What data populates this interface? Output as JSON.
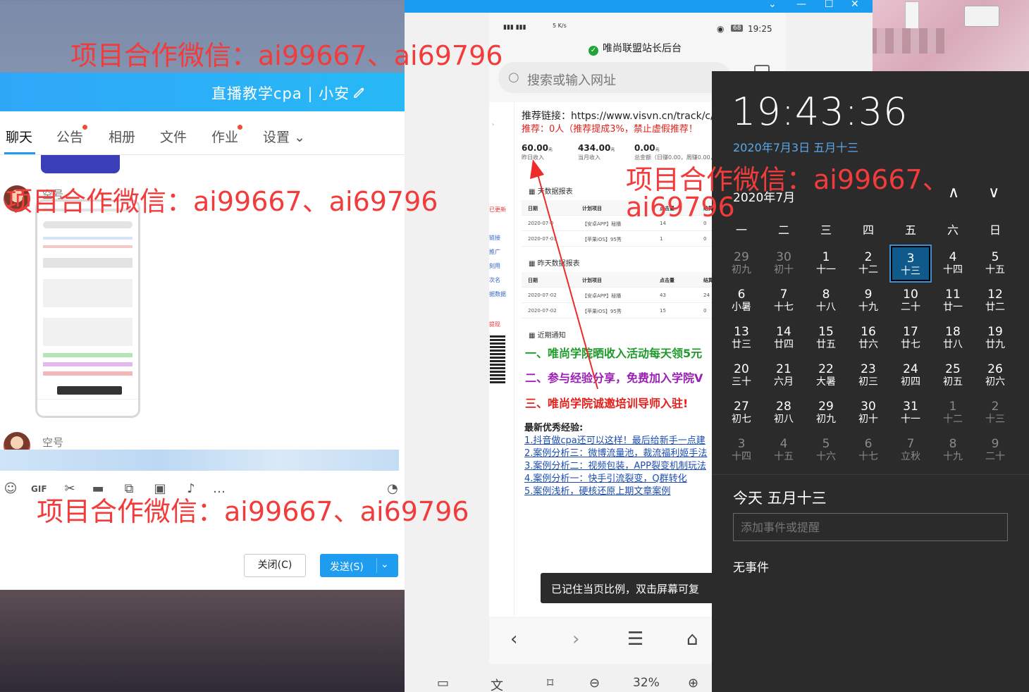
{
  "qq_window": {
    "title": "直播教学cpa | 小安",
    "tabs": [
      {
        "label": "聊天"
      },
      {
        "label": "公告"
      },
      {
        "label": "相册"
      },
      {
        "label": "文件"
      },
      {
        "label": "作业"
      },
      {
        "label": "设置"
      }
    ],
    "sender_top": "空号",
    "sender_bottom": "空号",
    "close_button": "关闭(C)",
    "send_button": "发送(S)"
  },
  "phone": {
    "status_speed": "5 K/s",
    "battery": "68",
    "time": "19:25",
    "site_title": "唯尚联盟站长后台",
    "search_placeholder": "搜索或输入网址",
    "referral_link": "推荐链接：https://www.visvn.cn/track/c/",
    "referral_note": "推荐：0人（推荐提成3%，禁止虚假推荐！",
    "stats": [
      {
        "value": "60.00",
        "unit": "元",
        "label": "昨日收入"
      },
      {
        "value": "434.00",
        "unit": "元",
        "label": "当月收入"
      },
      {
        "value": "0.00",
        "unit": "元",
        "label": "总金额（日赚0.00，周赚0.00，下线"
      }
    ],
    "section_today": "天数据报表",
    "section_yesterday": "昨天数据报表",
    "section_notice": "近期通知",
    "table_headers": [
      "日期",
      "计划项目",
      "点击量",
      "结算"
    ],
    "today_rows": [
      [
        "2020-07-0",
        "【安卓APP】秘播",
        "14",
        "0"
      ],
      [
        "2020-07-03",
        "【苹果iOS】95秀",
        "1",
        "0"
      ]
    ],
    "yesterday_rows": [
      [
        "2020-07-02",
        "【安卓APP】秘播",
        "43",
        "24"
      ],
      [
        "2020-07-02",
        "【苹果iOS】95秀",
        "15",
        "0"
      ]
    ],
    "left_links": [
      "已更新",
      "链接",
      "推广",
      "刻用",
      "次名",
      "据数据",
      "提现"
    ],
    "notices": [
      {
        "text": "一、唯尚学院晒收入活动每天领5元",
        "color": "#1f9a2b"
      },
      {
        "text": "二、参与经验分享，免费加入学院V",
        "color": "#9b1fb5"
      },
      {
        "text": "三、唯尚学院诚邀培训导师入驻!",
        "color": "#e3201b"
      }
    ],
    "experience_title": "最新优秀经验:",
    "experience_links": [
      "1.抖音做cpa还可以这样！最后给新手一点建",
      "2.案例分析三：微博流量池，裁流福利姬手法",
      "3.案例分析二：视频包装，APP裂变机制玩法",
      "4.案例分析一：快手引流裂变，Q群转化",
      "5.案例浅析，硬核还原上期文章案例"
    ],
    "toast": "已记住当页比例，双击屏幕可复",
    "zoom": "32%"
  },
  "calendar": {
    "time": "19:43:36",
    "date_line": "2020年7月3日 五月十三",
    "month": "2020年7月",
    "weekdays": [
      "一",
      "二",
      "三",
      "四",
      "五",
      "六",
      "日"
    ],
    "days": [
      {
        "n": "29",
        "l": "初九",
        "dim": true
      },
      {
        "n": "30",
        "l": "初十",
        "dim": true
      },
      {
        "n": "1",
        "l": "十一"
      },
      {
        "n": "2",
        "l": "十二"
      },
      {
        "n": "3",
        "l": "十三",
        "today": true
      },
      {
        "n": "4",
        "l": "十四"
      },
      {
        "n": "5",
        "l": "十五"
      },
      {
        "n": "6",
        "l": "小暑"
      },
      {
        "n": "7",
        "l": "十七"
      },
      {
        "n": "8",
        "l": "十八"
      },
      {
        "n": "9",
        "l": "十九"
      },
      {
        "n": "10",
        "l": "二十"
      },
      {
        "n": "11",
        "l": "廿一"
      },
      {
        "n": "12",
        "l": "廿二"
      },
      {
        "n": "13",
        "l": "廿三"
      },
      {
        "n": "14",
        "l": "廿四"
      },
      {
        "n": "15",
        "l": "廿五"
      },
      {
        "n": "16",
        "l": "廿六"
      },
      {
        "n": "17",
        "l": "廿七"
      },
      {
        "n": "18",
        "l": "廿八"
      },
      {
        "n": "19",
        "l": "廿九"
      },
      {
        "n": "20",
        "l": "三十"
      },
      {
        "n": "21",
        "l": "六月"
      },
      {
        "n": "22",
        "l": "大暑"
      },
      {
        "n": "23",
        "l": "初三"
      },
      {
        "n": "24",
        "l": "初四"
      },
      {
        "n": "25",
        "l": "初五"
      },
      {
        "n": "26",
        "l": "初六"
      },
      {
        "n": "27",
        "l": "初七"
      },
      {
        "n": "28",
        "l": "初八"
      },
      {
        "n": "29",
        "l": "初九"
      },
      {
        "n": "30",
        "l": "初十"
      },
      {
        "n": "31",
        "l": "十一"
      },
      {
        "n": "1",
        "l": "十二",
        "dim": true
      },
      {
        "n": "2",
        "l": "十三",
        "dim": true
      },
      {
        "n": "3",
        "l": "十四",
        "dim": true
      },
      {
        "n": "4",
        "l": "十五",
        "dim": true
      },
      {
        "n": "5",
        "l": "十六",
        "dim": true
      },
      {
        "n": "6",
        "l": "十七",
        "dim": true
      },
      {
        "n": "7",
        "l": "立秋",
        "dim": true
      },
      {
        "n": "8",
        "l": "十九",
        "dim": true
      },
      {
        "n": "9",
        "l": "二十",
        "dim": true
      }
    ],
    "today_label": "今天 五月十三",
    "event_placeholder": "添加事件或提醒",
    "no_events": "无事件"
  },
  "watermarks": [
    "项目合作微信：ai99667、ai69796",
    "项目合作微信：ai99667、ai69796",
    "项目合作微信：ai99667、ai69796",
    "项目合作微信：ai99667、",
    "ai69796"
  ],
  "colors": {
    "qq_blue": "#1e9cf0",
    "calendar_bg": "#2b2b2b",
    "calendar_accent": "#5aa7e8",
    "watermark": "#f23b3b"
  }
}
